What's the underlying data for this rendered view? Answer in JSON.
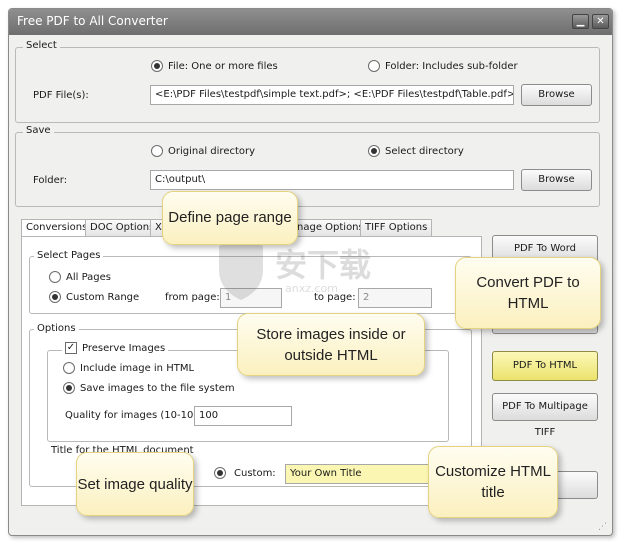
{
  "window": {
    "title": "Free PDF to All Converter",
    "minimize_glyph": "▁",
    "close_glyph": "✕"
  },
  "select": {
    "group_title": "Select",
    "option_file": "File:  One or more files",
    "option_folder": "Folder: Includes sub-folder",
    "pdf_label": "PDF File(s):",
    "pdf_value": "<E:\\PDF Files\\testpdf\\simple text.pdf>; <E:\\PDF Files\\testpdf\\Table.pdf>; <E:\\PDF",
    "browse": "Browse"
  },
  "save": {
    "group_title": "Save",
    "option_original": "Original directory",
    "option_select": "Select directory",
    "folder_label": "Folder:",
    "folder_value": "C:\\output\\",
    "browse": "Browse"
  },
  "tabs": [
    "Conversions",
    "DOC Options",
    "X",
    "nage Options",
    "TIFF Options"
  ],
  "pages": {
    "group_title": "Select Pages",
    "all_pages": "All Pages",
    "custom_range": "Custom Range",
    "from_label": "from page:",
    "from_value": "1",
    "to_label": "to page:",
    "to_value": "2"
  },
  "options": {
    "group_title": "Options",
    "preserve_images": "Preserve Images",
    "check_glyph": "✓",
    "include_in_html": "Include image in HTML",
    "save_to_fs": "Save images to the file system",
    "quality_label": "Quality for images (10-100):",
    "quality_value": "100",
    "title_label": "Title for the HTML document",
    "custom_label": "Custom:",
    "custom_value": "Your Own Title"
  },
  "actions": {
    "to_word": "PDF To Word",
    "to_html": "PDF To HTML",
    "to_tiff": "PDF To Multipage TIFF"
  },
  "callouts": {
    "page_range": "Define page range",
    "convert_html": "Convert PDF to HTML",
    "store_images": "Store images inside or outside HTML",
    "image_quality": "Set image quality",
    "html_title": "Customize HTML title"
  },
  "watermark": {
    "text": "安下载",
    "subtext": "anxz.com"
  },
  "colors": {
    "accent_button": "#f3ef8a",
    "callout": "#fdf6cf",
    "titlebar": "#7a7a7a"
  }
}
